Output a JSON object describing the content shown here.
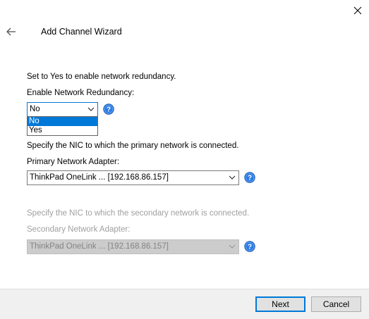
{
  "window": {
    "title": "Add Channel Wizard"
  },
  "redundancy": {
    "description": "Set to Yes to enable network redundancy.",
    "label": "Enable Network Redundancy:",
    "selected": "No",
    "options": [
      "No",
      "Yes"
    ],
    "highlighted_option": "No"
  },
  "primary": {
    "description": "Specify the NIC to which the primary network is connected.",
    "label": "Primary Network Adapter:",
    "selected": "ThinkPad OneLink ... [192.168.86.157]"
  },
  "secondary": {
    "description": "Specify the NIC to which the secondary network is connected.",
    "label": "Secondary Network Adapter:",
    "selected": "ThinkPad OneLink ... [192.168.86.157]",
    "enabled": false
  },
  "buttons": {
    "next": "Next",
    "cancel": "Cancel"
  },
  "icons": {
    "close": "close-icon",
    "back": "back-arrow-icon",
    "help": "help-icon",
    "dropdown": "chevron-down-icon"
  },
  "colors": {
    "accent": "#0078d7",
    "help_icon": "#1f6fd1",
    "disabled_text": "#a0a0a0",
    "footer_bg": "#f0f0f0"
  }
}
